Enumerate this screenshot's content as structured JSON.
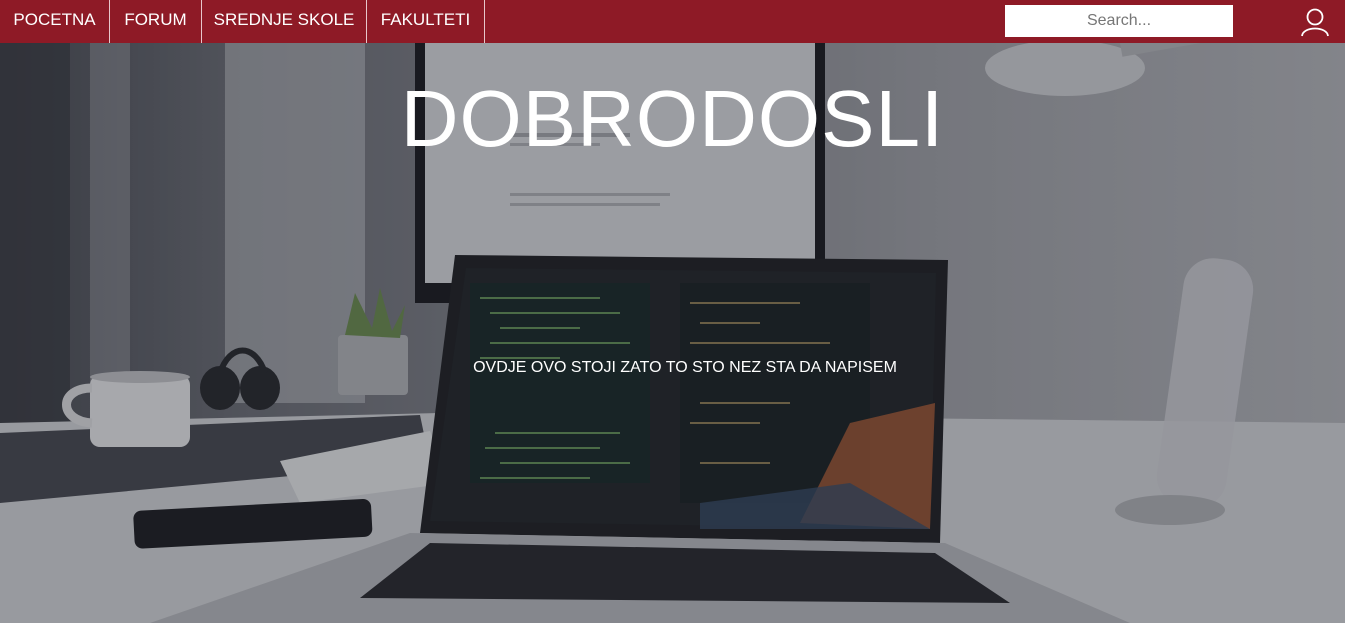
{
  "nav": {
    "links": [
      "POCETNA",
      "FORUM",
      "SREDNJE SKOLE",
      "FAKULTETI"
    ]
  },
  "search": {
    "placeholder": "Search..."
  },
  "hero": {
    "title": "DOBRODOSLI",
    "subtitle": "OVDJE OVO STOJI ZATO TO STO NEZ STA DA NAPISEM"
  },
  "colors": {
    "navbar": "#8e1a26",
    "text": "#ffffff"
  }
}
